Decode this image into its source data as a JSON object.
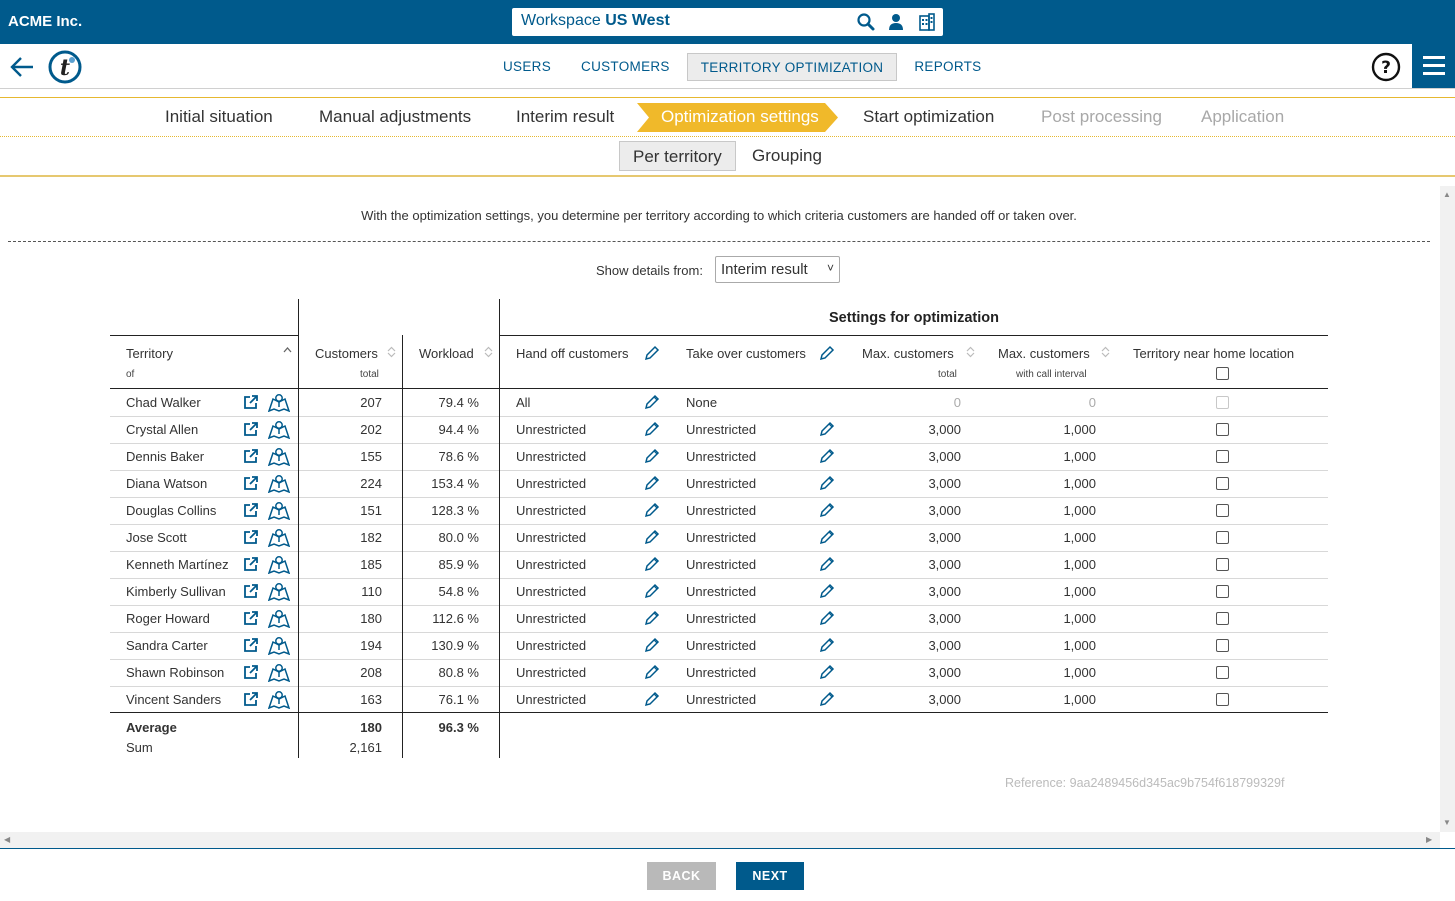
{
  "app": {
    "company": "ACME Inc.",
    "workspace_prefix": "Workspace",
    "workspace_name": "US West"
  },
  "nav": {
    "links": [
      "USERS",
      "CUSTOMERS",
      "TERRITORY OPTIMIZATION",
      "REPORTS"
    ],
    "active": "TERRITORY OPTIMIZATION"
  },
  "steps": {
    "initial": "Initial situation",
    "manual": "Manual adjustments",
    "interim": "Interim result",
    "optimization": "Optimization settings",
    "start": "Start optimization",
    "post": "Post processing",
    "application": "Application"
  },
  "subtabs": {
    "per_territory": "Per territory",
    "grouping": "Grouping"
  },
  "intro": "With the optimization settings, you determine per territory according to which criteria customers are handed off or taken over.",
  "details": {
    "label": "Show details from:",
    "selected": "Interim result"
  },
  "table": {
    "settings_header": "Settings for optimization",
    "headers": {
      "territory": "Territory",
      "territory_sub": "of",
      "customers": "Customers",
      "customers_sub": "total",
      "workload": "Workload",
      "handoff": "Hand off customers",
      "takeover": "Take over customers",
      "max_total": "Max. customers",
      "max_total_sub": "total",
      "max_interval": "Max. customers",
      "max_interval_sub": "with call interval",
      "near_home": "Territory near home location"
    },
    "rows": [
      {
        "name": "Chad Walker",
        "customers": "207",
        "workload": "79.4 %",
        "handoff": "All",
        "takeover": "None",
        "max_total": "0",
        "max_interval": "0",
        "disabled": true
      },
      {
        "name": "Crystal Allen",
        "customers": "202",
        "workload": "94.4 %",
        "handoff": "Unrestricted",
        "takeover": "Unrestricted",
        "max_total": "3,000",
        "max_interval": "1,000",
        "disabled": false
      },
      {
        "name": "Dennis Baker",
        "customers": "155",
        "workload": "78.6 %",
        "handoff": "Unrestricted",
        "takeover": "Unrestricted",
        "max_total": "3,000",
        "max_interval": "1,000",
        "disabled": false
      },
      {
        "name": "Diana Watson",
        "customers": "224",
        "workload": "153.4 %",
        "handoff": "Unrestricted",
        "takeover": "Unrestricted",
        "max_total": "3,000",
        "max_interval": "1,000",
        "disabled": false
      },
      {
        "name": "Douglas Collins",
        "customers": "151",
        "workload": "128.3 %",
        "handoff": "Unrestricted",
        "takeover": "Unrestricted",
        "max_total": "3,000",
        "max_interval": "1,000",
        "disabled": false
      },
      {
        "name": "Jose Scott",
        "customers": "182",
        "workload": "80.0 %",
        "handoff": "Unrestricted",
        "takeover": "Unrestricted",
        "max_total": "3,000",
        "max_interval": "1,000",
        "disabled": false
      },
      {
        "name": "Kenneth Martínez",
        "customers": "185",
        "workload": "85.9 %",
        "handoff": "Unrestricted",
        "takeover": "Unrestricted",
        "max_total": "3,000",
        "max_interval": "1,000",
        "disabled": false
      },
      {
        "name": "Kimberly Sullivan",
        "customers": "110",
        "workload": "54.8 %",
        "handoff": "Unrestricted",
        "takeover": "Unrestricted",
        "max_total": "3,000",
        "max_interval": "1,000",
        "disabled": false
      },
      {
        "name": "Roger Howard",
        "customers": "180",
        "workload": "112.6 %",
        "handoff": "Unrestricted",
        "takeover": "Unrestricted",
        "max_total": "3,000",
        "max_interval": "1,000",
        "disabled": false
      },
      {
        "name": "Sandra Carter",
        "customers": "194",
        "workload": "130.9 %",
        "handoff": "Unrestricted",
        "takeover": "Unrestricted",
        "max_total": "3,000",
        "max_interval": "1,000",
        "disabled": false
      },
      {
        "name": "Shawn Robinson",
        "customers": "208",
        "workload": "80.8 %",
        "handoff": "Unrestricted",
        "takeover": "Unrestricted",
        "max_total": "3,000",
        "max_interval": "1,000",
        "disabled": false
      },
      {
        "name": "Vincent Sanders",
        "customers": "163",
        "workload": "76.1 %",
        "handoff": "Unrestricted",
        "takeover": "Unrestricted",
        "max_total": "3,000",
        "max_interval": "1,000",
        "disabled": false
      }
    ],
    "footer": {
      "avg_label": "Average",
      "avg_customers": "180",
      "avg_workload": "96.3 %",
      "sum_label": "Sum",
      "sum_customers": "2,161"
    }
  },
  "reference": "Reference: 9aa2489456d345ac9b754f618799329f",
  "buttons": {
    "back": "BACK",
    "next": "NEXT"
  },
  "icons": {
    "search": "search-icon",
    "user": "user-icon",
    "building": "building-icon",
    "back": "arrow-left-icon",
    "logo": "logo-icon",
    "help": "help-icon",
    "menu": "hamburger-menu-icon",
    "edit": "pencil-icon",
    "open": "open-external-icon",
    "map": "map-icon"
  },
  "colors": {
    "brand": "#005a8c",
    "step_active": "#f0b92a",
    "accent_line": "#e6b830"
  }
}
